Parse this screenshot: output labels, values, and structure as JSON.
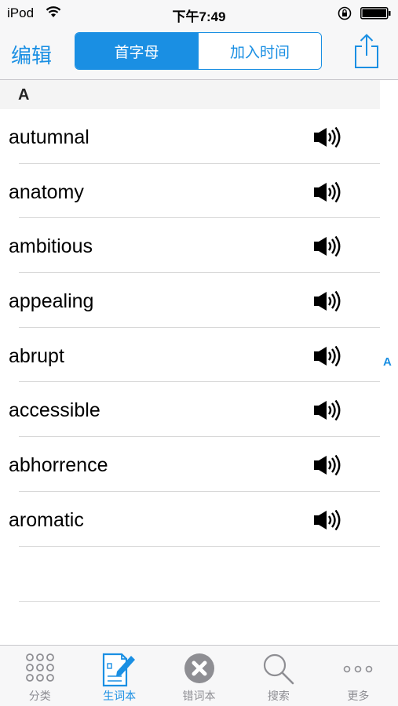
{
  "status": {
    "carrier": "iPod",
    "time": "下午7:49"
  },
  "nav": {
    "edit_label": "编辑",
    "segments": [
      {
        "label": "首字母",
        "active": true
      },
      {
        "label": "加入时间",
        "active": false
      }
    ],
    "share_icon": "share-icon"
  },
  "section": {
    "header": "A",
    "index_letter": "A"
  },
  "words": [
    {
      "text": "autumnal"
    },
    {
      "text": "anatomy"
    },
    {
      "text": "ambitious"
    },
    {
      "text": "appealing"
    },
    {
      "text": "abrupt"
    },
    {
      "text": "accessible"
    },
    {
      "text": "abhorrence"
    },
    {
      "text": "aromatic"
    }
  ],
  "tabs": [
    {
      "label": "分类",
      "icon": "grid-icon",
      "active": false
    },
    {
      "label": "生词本",
      "icon": "notebook-edit-icon",
      "active": true
    },
    {
      "label": "错词本",
      "icon": "close-circle-icon",
      "active": false
    },
    {
      "label": "搜索",
      "icon": "search-icon",
      "active": false
    },
    {
      "label": "更多",
      "icon": "more-icon",
      "active": false
    }
  ],
  "colors": {
    "accent": "#1a8fe3",
    "tab_inactive": "#8e8e93"
  }
}
